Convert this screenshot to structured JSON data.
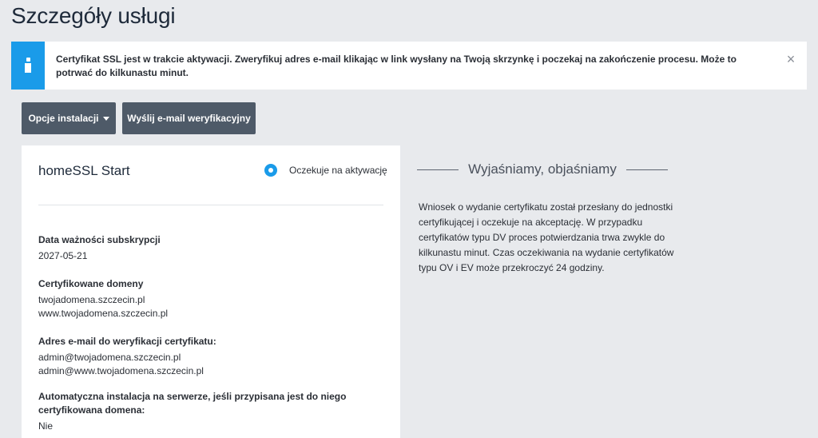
{
  "page": {
    "title": "Szczegóły usługi"
  },
  "alert": {
    "message": "Certyfikat SSL jest w trakcie aktywacji. Zweryfikuj adres e-mail klikając w link wysłany na Twoją skrzynkę i poczekaj na zakończenie procesu. Może to potrwać do kilkunastu minut.",
    "icon": "info-icon",
    "close_label": "×"
  },
  "toolbar": {
    "options_label": "Opcje instalacji",
    "verify_label": "Wyślij e-mail weryfikacyjny"
  },
  "card": {
    "title": "homeSSL Start",
    "status": "Oczekuje na aktywację",
    "sections": [
      {
        "label": "Data ważności subskrypcji",
        "values": [
          "2027-05-21"
        ]
      },
      {
        "label": "Certyfikowane domeny",
        "values": [
          "twojadomena.szczecin.pl",
          "www.twojadomena.szczecin.pl"
        ]
      },
      {
        "label": "Adres e-mail do weryfikacji certyfikatu:",
        "values": [
          "admin@twojadomena.szczecin.pl",
          "admin@www.twojadomena.szczecin.pl"
        ]
      },
      {
        "label": "Automatyczna instalacja na serwerze, jeśli przypisana jest do niego certyfikowana domena:",
        "values": [
          "Nie"
        ]
      }
    ]
  },
  "sidebar": {
    "heading": "Wyjaśniamy, objaśniamy",
    "text": "Wniosek o wydanie certyfikatu został przesłany do jednostki certyfikującej i oczekuje na akceptację. W przypadku certyfikatów typu DV proces potwierdzania trwa zwykle do kilkunastu minut. Czas oczekiwania na wydanie certyfikatów typu OV i EV może przekroczyć 24 godziny."
  },
  "colors": {
    "accent": "#1a9be9",
    "button": "#4e5a68",
    "background": "#e8eaed"
  }
}
